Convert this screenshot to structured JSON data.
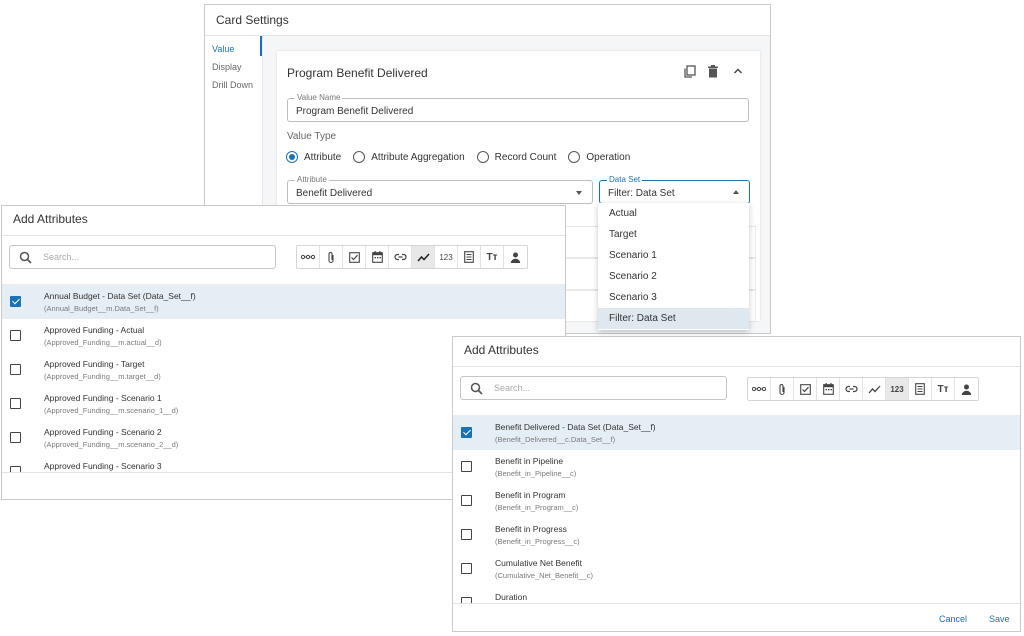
{
  "card_settings": {
    "title": "Card Settings",
    "nav": [
      "Value",
      "Display",
      "Drill Down"
    ],
    "value_card": {
      "title": "Program Benefit Delivered",
      "value_name": {
        "label": "Value Name",
        "value": "Program Benefit Delivered"
      },
      "value_type_label": "Value Type",
      "value_types": [
        "Attribute",
        "Attribute Aggregation",
        "Record Count",
        "Operation"
      ],
      "selected_value_type": "Attribute",
      "attribute": {
        "label": "Attribute",
        "value": "Benefit Delivered"
      },
      "data_set": {
        "label": "Data Set",
        "value": "Filter: Data Set"
      },
      "icons": [
        "copy-icon",
        "delete-icon",
        "chevron-up-icon"
      ]
    },
    "data_set_options": [
      "Actual",
      "Target",
      "Scenario 1",
      "Scenario 2",
      "Scenario 3",
      "Filter: Data Set"
    ],
    "selected_data_set": "Filter: Data Set"
  },
  "add_attributes_left": {
    "title": "Add Attributes",
    "search_placeholder": "Search...",
    "type_filters": [
      "lookup-icon",
      "attachment-icon",
      "checkbox-icon",
      "calendar-icon",
      "link-icon",
      "trend-icon",
      "number-icon",
      "list-icon",
      "text-icon",
      "user-icon"
    ],
    "active_filter": "trend-icon",
    "number_filter_label": "123",
    "text_filter_label": "Tт",
    "items": [
      {
        "name": "Annual Budget - Data Set (Data_Set__f)",
        "api": "(Annual_Budget__m.Data_Set__f)",
        "checked": true
      },
      {
        "name": "Approved Funding - Actual",
        "api": "(Approved_Funding__m.actual__d)",
        "checked": false
      },
      {
        "name": "Approved Funding - Target",
        "api": "(Approved_Funding__m.target__d)",
        "checked": false
      },
      {
        "name": "Approved Funding - Scenario 1",
        "api": "(Approved_Funding__m.scenario_1__d)",
        "checked": false
      },
      {
        "name": "Approved Funding - Scenario 2",
        "api": "(Approved_Funding__m.scenario_2__d)",
        "checked": false
      },
      {
        "name": "Approved Funding - Scenario 3",
        "api": "",
        "checked": false
      }
    ]
  },
  "add_attributes_right": {
    "title": "Add Attributes",
    "search_placeholder": "Search...",
    "type_filters": [
      "lookup-icon",
      "attachment-icon",
      "checkbox-icon",
      "calendar-icon",
      "link-icon",
      "trend-icon",
      "number-icon",
      "list-icon",
      "text-icon",
      "user-icon"
    ],
    "active_filter": "number-icon",
    "number_filter_label": "123",
    "text_filter_label": "Tт",
    "items": [
      {
        "name": "Benefit Delivered - Data Set (Data_Set__f)",
        "api": "(Benefit_Delivered__c.Data_Set__f)",
        "checked": true
      },
      {
        "name": "Benefit in Pipeline",
        "api": "(Benefit_in_Pipeline__c)",
        "checked": false
      },
      {
        "name": "Benefit in Program",
        "api": "(Benefit_in_Program__c)",
        "checked": false
      },
      {
        "name": "Benefit in Progress",
        "api": "(Benefit_in_Progress__c)",
        "checked": false
      },
      {
        "name": "Cumulative Net Benefit",
        "api": "(Cumulative_Net_Benefit__c)",
        "checked": false
      },
      {
        "name": "Duration",
        "api": "",
        "checked": false
      }
    ],
    "cancel_label": "Cancel",
    "save_label": "Save"
  },
  "colors": {
    "accent": "#1a73b8",
    "selected_row": "#e6eef5",
    "dropdown_selected": "#dfe7ef"
  }
}
